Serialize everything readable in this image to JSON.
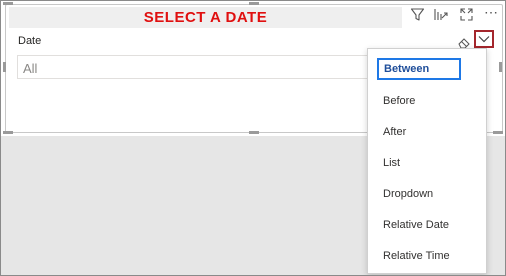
{
  "slicer": {
    "title": "SELECT A DATE",
    "field_label": "Date",
    "value": "All"
  },
  "toolbar": {
    "icons": [
      "filter-icon",
      "focus-mode-icon",
      "expand-icon",
      "more-options-icon"
    ],
    "more_label": "⋯"
  },
  "menu": {
    "selected": "Between",
    "items": [
      {
        "label": "Between"
      },
      {
        "label": "Before"
      },
      {
        "label": "After"
      },
      {
        "label": "List"
      },
      {
        "label": "Dropdown"
      },
      {
        "label": "Relative Date"
      },
      {
        "label": "Relative Time"
      }
    ]
  },
  "colors": {
    "title": "#e01010",
    "toggle_border": "#a4262c",
    "selected_border": "#1e78e6"
  }
}
